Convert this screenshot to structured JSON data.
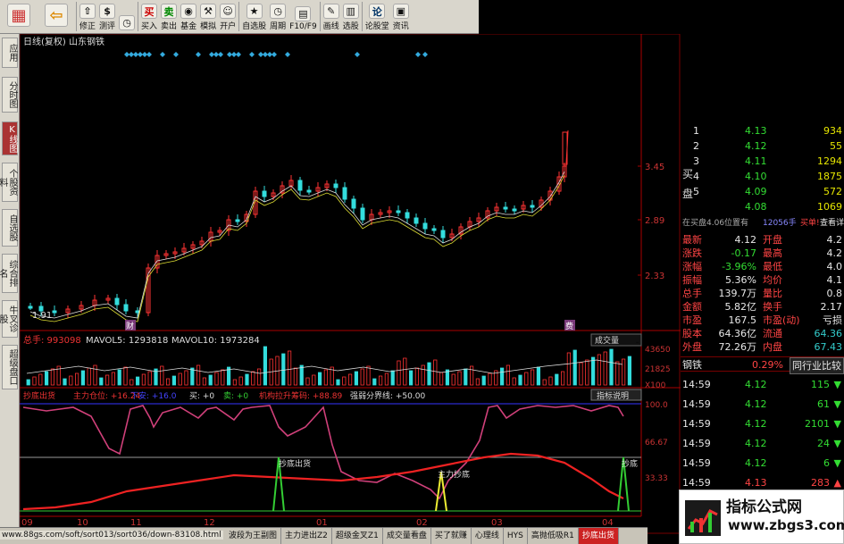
{
  "toolbar": {
    "items": [
      {
        "label": "",
        "icon": "grid-icon"
      },
      {
        "label": "",
        "icon": "back-arrow-icon"
      },
      {
        "label": "修正",
        "icon": "arrow-up-icon"
      },
      {
        "label": "测评",
        "icon": "dollar-icon"
      },
      {
        "label": "",
        "icon": "clock-icon"
      },
      {
        "label": "买入",
        "glyph": "买",
        "color": "#c00"
      },
      {
        "label": "卖出",
        "glyph": "卖",
        "color": "#080"
      },
      {
        "label": "基金",
        "icon": "coin-icon"
      },
      {
        "label": "模拟",
        "icon": "hammer-icon"
      },
      {
        "label": "开户",
        "icon": "user-icon"
      },
      {
        "label": "自选股",
        "icon": "star-list-icon"
      },
      {
        "label": "周期",
        "icon": "clock-icon"
      },
      {
        "label": "F10/F9",
        "icon": "doc-icon"
      },
      {
        "label": "画线",
        "icon": "pencil-icon"
      },
      {
        "label": "选股",
        "icon": "chart-select-icon"
      },
      {
        "label": "论股堂",
        "glyph": "论",
        "color": "#036"
      },
      {
        "label": "资讯",
        "icon": "news-icon"
      }
    ]
  },
  "sidebar": {
    "tabs": [
      "应用",
      "分时图",
      "K线图",
      "个股资料",
      "自选股",
      "综合排名",
      "牛叉诊股",
      "超级盘口"
    ],
    "active": 2
  },
  "chart": {
    "header": "日线(复权)  山东钢铁",
    "price_axis": [
      "3.45",
      "2.89",
      "2.33"
    ],
    "low_label": "1.91",
    "marker1": "财",
    "marker2": "费",
    "vol_header": {
      "a": "总手: 993098",
      "b": "MAVOL5: 1293818",
      "c": "MAVOL10: 1973284"
    },
    "vol_select": "成交量",
    "vol_axis": [
      "43650",
      "21825",
      "X100"
    ],
    "ind_header": {
      "a": "抄底出货",
      "b": "主力仓位: +16.24",
      "c": "下安: +16.0",
      "d": "买: +0",
      "e": "卖: +0",
      "f": "机构拉升筹码: +88.89",
      "g": "强弱分界线: +50.00"
    },
    "ind_button": "指标说明",
    "ind_axis": [
      "100.0",
      "66.67",
      "33.33"
    ],
    "ann1": "抄底出货",
    "ann2": "主力抄底",
    "ann3": "抄底",
    "date_axis": [
      "09",
      "10",
      "11",
      "12",
      "01",
      "02",
      "03",
      "04"
    ]
  },
  "quote": {
    "bid_label": "买盘",
    "bids": [
      {
        "lvl": "1",
        "price": "4.13",
        "vol": "934"
      },
      {
        "lvl": "2",
        "price": "4.12",
        "vol": "55"
      },
      {
        "lvl": "3",
        "price": "4.11",
        "vol": "1294"
      },
      {
        "lvl": "4",
        "price": "4.10",
        "vol": "1875"
      },
      {
        "lvl": "5",
        "price": "4.09",
        "vol": "572"
      },
      {
        "lvl": "",
        "price": "4.08",
        "vol": "1069"
      }
    ],
    "notice": {
      "a": "在买盘4.06位置有",
      "b": "12056手",
      "c": "买单!",
      "d": "查看详情"
    },
    "stats": [
      {
        "k1": "最新",
        "v1": "4.12",
        "k2": "开盘",
        "v2": "4.2"
      },
      {
        "k1": "涨跌",
        "v1": "-0.17",
        "k2": "最高",
        "v2": "4.2"
      },
      {
        "k1": "涨幅",
        "v1": "-3.96%",
        "k2": "最低",
        "v2": "4.0"
      },
      {
        "k1": "振幅",
        "v1": "5.36%",
        "k2": "均价",
        "v2": "4.1"
      },
      {
        "k1": "总手",
        "v1": "139.7万",
        "k2": "量比",
        "v2": "0.8"
      },
      {
        "k1": "金额",
        "v1": "5.82亿",
        "k2": "换手",
        "v2": "2.17"
      },
      {
        "k1": "市盈",
        "v1": "167.5",
        "k2": "市盈(动)",
        "v2": "亏损"
      },
      {
        "k1": "股本",
        "v1": "64.36亿",
        "k2": "流通",
        "v2": "64.36"
      },
      {
        "k1": "外盘",
        "v1": "72.26万",
        "k2": "内盘",
        "v2": "67.43"
      }
    ],
    "industry": {
      "name": "钢铁",
      "pct": "0.29%",
      "link": "同行业比较"
    },
    "ticks": [
      {
        "t": "14:59",
        "p": "4.12",
        "v": "115",
        "d": "down"
      },
      {
        "t": "14:59",
        "p": "4.12",
        "v": "61",
        "d": "down"
      },
      {
        "t": "14:59",
        "p": "4.12",
        "v": "2101",
        "d": "down"
      },
      {
        "t": "14:59",
        "p": "4.12",
        "v": "24",
        "d": "down"
      },
      {
        "t": "14:59",
        "p": "4.12",
        "v": "6",
        "d": "down"
      },
      {
        "t": "14:59",
        "p": "4.13",
        "v": "283",
        "d": "up"
      },
      {
        "t": "14:59",
        "p": "4.12",
        "v": "",
        "d": ""
      }
    ]
  },
  "bottom": {
    "url": "www.88gs.com/soft/sort013/sort036/down-83108.html",
    "tabs": [
      "波段为王副图",
      "主力进出Z2",
      "超级金叉Z1",
      "成交量看盘",
      "买了就赚",
      "心理线",
      "HYS",
      "高抛低吸R1",
      "抄底出货"
    ],
    "active": 8
  },
  "watermark": {
    "line1": "指标公式网",
    "line2": "www.zbgs3.com"
  }
}
